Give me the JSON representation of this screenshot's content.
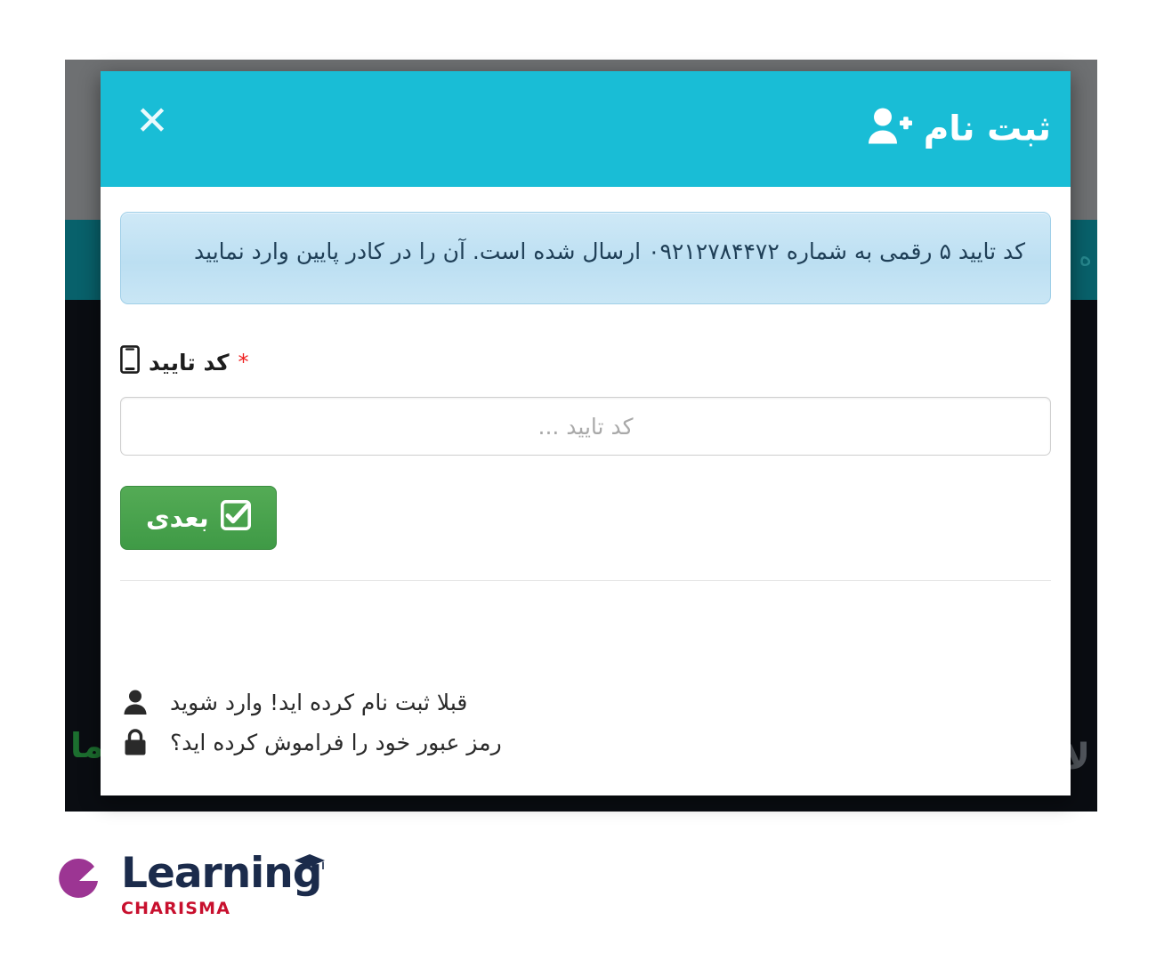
{
  "modal": {
    "header": {
      "title": "ثبت نام",
      "icon": "user-plus-icon",
      "close_label": "✕",
      "bg_color": "#19bdd6"
    },
    "alert": {
      "message": "کد تایید ۵ رقمی به شماره ۰۹۲۱۲۷۸۴۴۷۲ ارسال شده است. آن را در کادر پایین وارد نمایید",
      "phone": "۰۹۲۱۲۷۸۴۴۷۲",
      "code_length": "۵"
    },
    "field": {
      "label": "کد تایید",
      "required_mark": "*",
      "icon": "mobile-icon",
      "value": "",
      "placeholder": "کد تایید ..."
    },
    "submit": {
      "label": "بعدی",
      "icon": "check-square-icon",
      "color": "#4aa04c"
    },
    "footer": {
      "links": [
        {
          "text": "قبلا ثبت نام کرده اید! وارد شوید",
          "icon": "user-icon"
        },
        {
          "text": "رمز عبور خود را فراموش کرده اید؟",
          "icon": "lock-icon"
        }
      ]
    }
  },
  "backdrop": {
    "green_text": "ما",
    "gray_text": "لا",
    "teal_text": "ه"
  },
  "brand": {
    "name": "Learning",
    "subtitle": "CHARISMA",
    "mark_color": "#9c3593",
    "word_color": "#1b2b4b",
    "sub_color": "#c8102e"
  }
}
